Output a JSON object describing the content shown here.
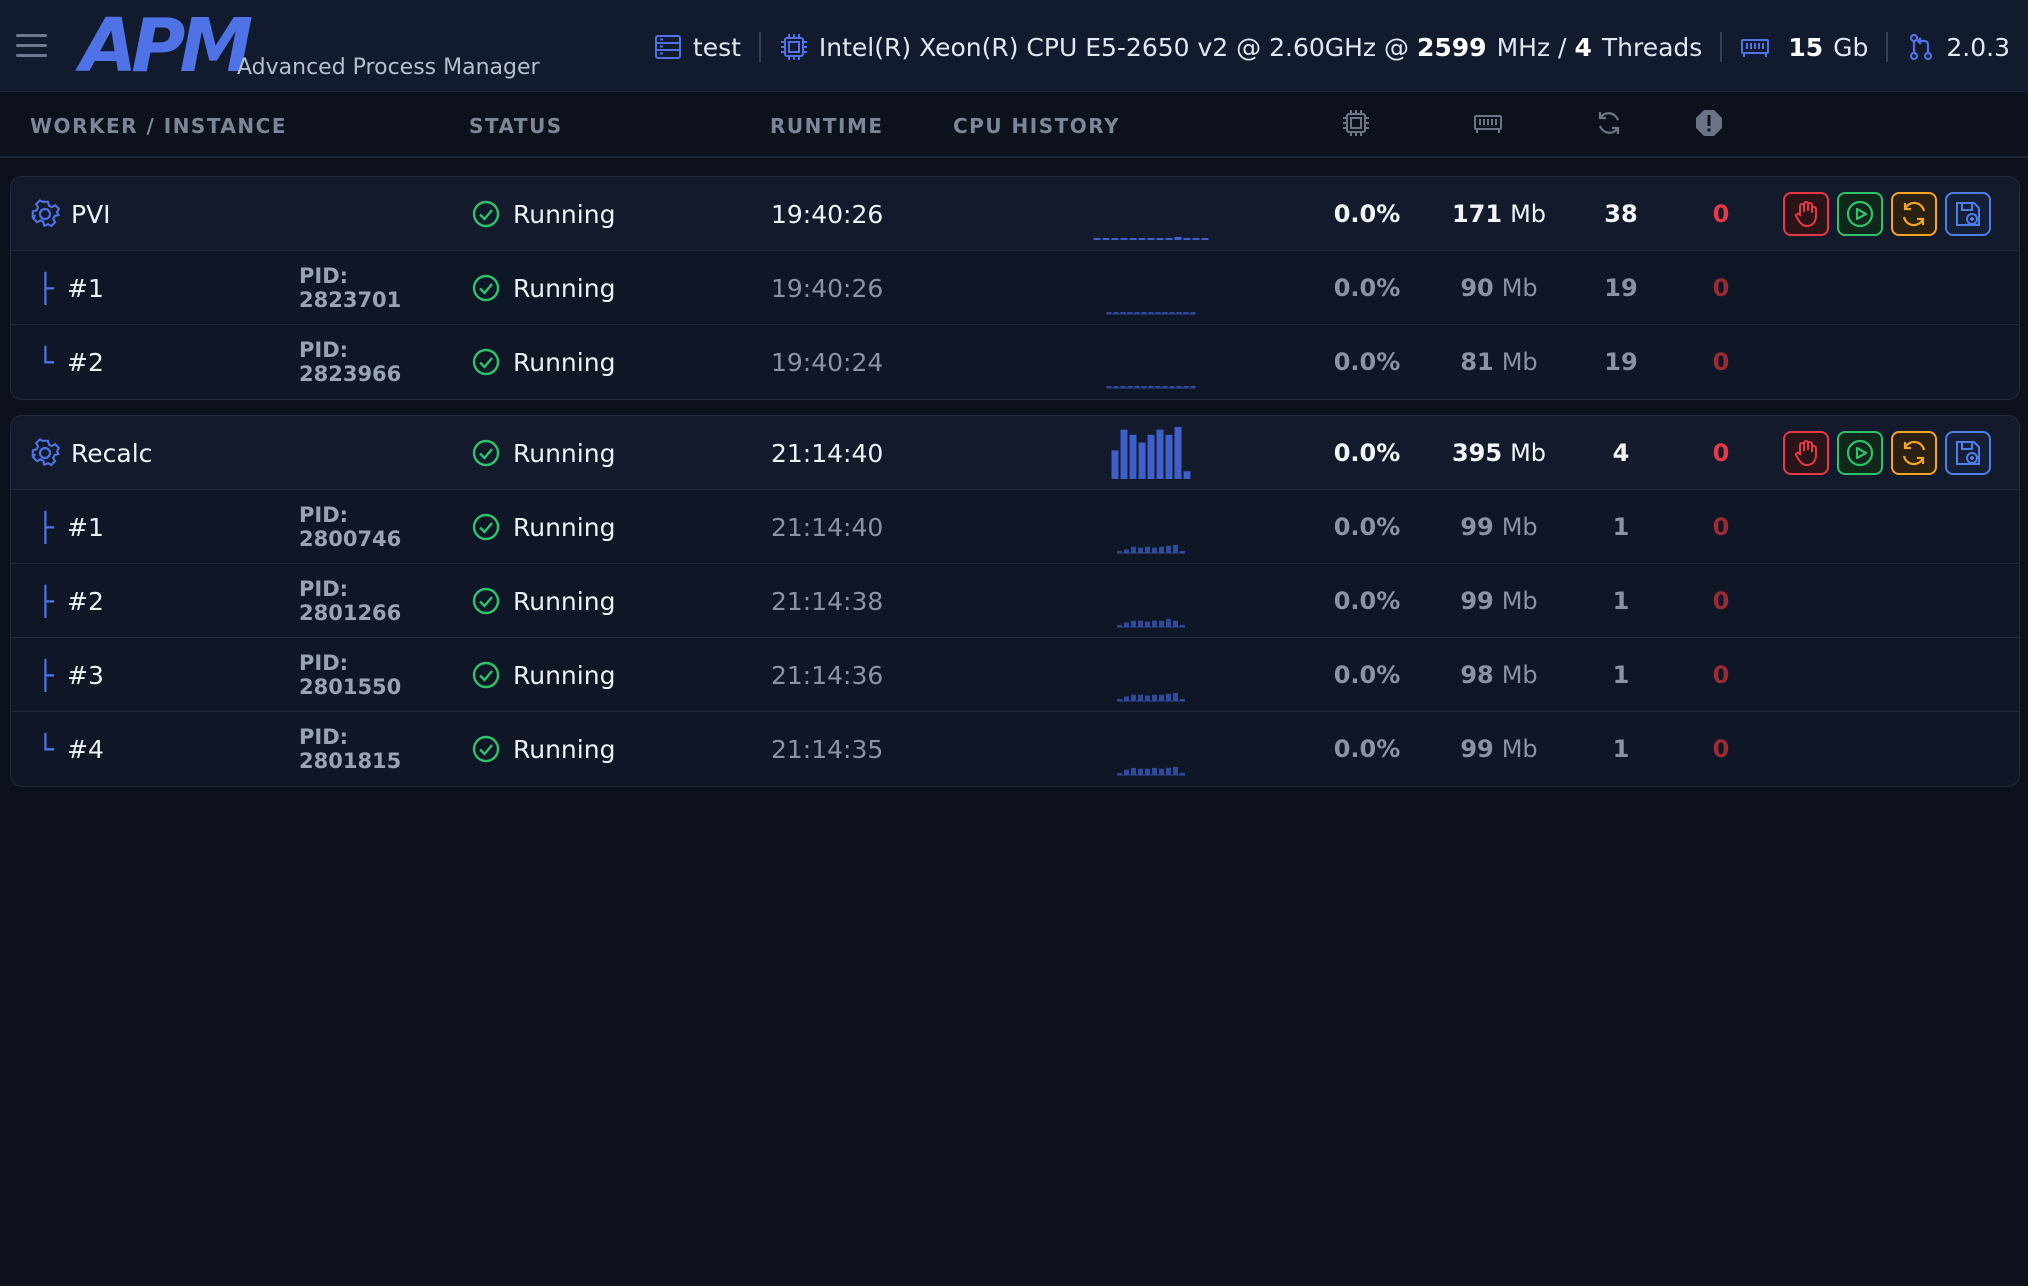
{
  "app": {
    "logo": "APM",
    "subtitle": "Advanced Process Manager"
  },
  "system": {
    "host_icon": "server-icon",
    "host": "test",
    "cpu_icon": "cpu-icon",
    "cpu_model": "Intel(R) Xeon(R) CPU E5-2650 v2 @ 2.60GHz @",
    "cpu_mhz": "2599",
    "mhz_label": "MHz /",
    "threads": "4",
    "threads_label": "Threads",
    "ram_icon": "memory-icon",
    "ram": "15",
    "ram_unit": "Gb",
    "version_icon": "git-branch-icon",
    "version": "2.0.3"
  },
  "columns": {
    "worker": "WORKER / INSTANCE",
    "status": "STATUS",
    "runtime": "RUNTIME",
    "cpu_history": "CPU HISTORY",
    "cpu_icon": "cpu-icon",
    "memory_icon": "memory-icon",
    "restarts_icon": "restart-icon",
    "errors_icon": "alert-icon"
  },
  "colors": {
    "accent": "#4f72e6",
    "running": "#2ec26b",
    "error": "#e63946",
    "restart": "#f5a524"
  },
  "groups": [
    {
      "name": "PVI",
      "status": "Running",
      "runtime": "19:40:26",
      "cpu": "0.0%",
      "memory": "171",
      "memory_unit": "Mb",
      "restarts": "38",
      "errors": "0",
      "cpu_history": [
        0,
        0,
        0,
        0,
        0,
        0,
        0,
        0.03,
        0,
        0.06,
        0.04,
        0,
        0
      ],
      "instances": [
        {
          "id": "#1",
          "pid": "PID: 2823701",
          "status": "Running",
          "runtime": "19:40:26",
          "cpu": "0.0%",
          "memory": "90",
          "memory_unit": "Mb",
          "restarts": "19",
          "errors": "0",
          "cpu_history": [
            0,
            0,
            0,
            0,
            0,
            0,
            0,
            0.03,
            0,
            0.05,
            0.03,
            0,
            0
          ]
        },
        {
          "id": "#2",
          "pid": "PID: 2823966",
          "status": "Running",
          "runtime": "19:40:24",
          "cpu": "0.0%",
          "memory": "81",
          "memory_unit": "Mb",
          "restarts": "19",
          "errors": "0",
          "cpu_history": [
            0,
            0,
            0,
            0,
            0,
            0,
            0,
            0,
            0,
            0.02,
            0,
            0,
            0
          ]
        }
      ]
    },
    {
      "name": "Recalc",
      "status": "Running",
      "runtime": "21:14:40",
      "cpu": "0.0%",
      "memory": "395",
      "memory_unit": "Mb",
      "restarts": "4",
      "errors": "0",
      "cpu_history": [
        0.55,
        0.95,
        0.85,
        0.7,
        0.85,
        0.95,
        0.85,
        1.0,
        0.15
      ],
      "instances": [
        {
          "id": "#1",
          "pid": "PID: 2800746",
          "status": "Running",
          "runtime": "21:14:40",
          "cpu": "0.0%",
          "memory": "99",
          "memory_unit": "Mb",
          "restarts": "1",
          "errors": "0",
          "cpu_history": [
            0.05,
            0.2,
            0.35,
            0.3,
            0.35,
            0.3,
            0.35,
            0.4,
            0.45,
            0.05
          ]
        },
        {
          "id": "#2",
          "pid": "PID: 2801266",
          "status": "Running",
          "runtime": "21:14:38",
          "cpu": "0.0%",
          "memory": "99",
          "memory_unit": "Mb",
          "restarts": "1",
          "errors": "0",
          "cpu_history": [
            0.05,
            0.25,
            0.35,
            0.35,
            0.3,
            0.35,
            0.35,
            0.45,
            0.35,
            0.05
          ]
        },
        {
          "id": "#3",
          "pid": "PID: 2801550",
          "status": "Running",
          "runtime": "21:14:36",
          "cpu": "0.0%",
          "memory": "98",
          "memory_unit": "Mb",
          "restarts": "1",
          "errors": "0",
          "cpu_history": [
            0.05,
            0.25,
            0.35,
            0.35,
            0.3,
            0.35,
            0.35,
            0.4,
            0.45,
            0.05
          ]
        },
        {
          "id": "#4",
          "pid": "PID: 2801815",
          "status": "Running",
          "runtime": "21:14:35",
          "cpu": "0.0%",
          "memory": "99",
          "memory_unit": "Mb",
          "restarts": "1",
          "errors": "0",
          "cpu_history": [
            0.05,
            0.3,
            0.4,
            0.35,
            0.35,
            0.4,
            0.35,
            0.4,
            0.45,
            0.05
          ]
        }
      ]
    }
  ]
}
